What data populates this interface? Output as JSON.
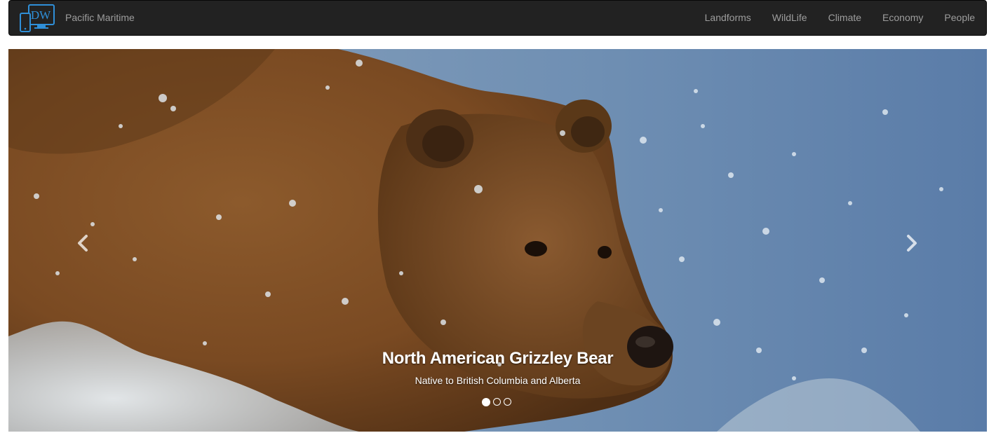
{
  "navbar": {
    "brand": "Pacific Maritime",
    "logo_text": "DW",
    "items": [
      {
        "label": "Landforms"
      },
      {
        "label": "WildLife"
      },
      {
        "label": "Climate"
      },
      {
        "label": "Economy"
      },
      {
        "label": "People"
      }
    ]
  },
  "carousel": {
    "active_index": 0,
    "slide_count": 3,
    "caption_title": "North American Grizzley Bear",
    "caption_text": "Native to British Columbia and Alberta",
    "prev_icon": "chevron-left-icon",
    "next_icon": "chevron-right-icon"
  },
  "colors": {
    "navbar_bg": "#222222",
    "nav_text": "#9d9d9d",
    "logo_blue": "#2f8fd8"
  }
}
